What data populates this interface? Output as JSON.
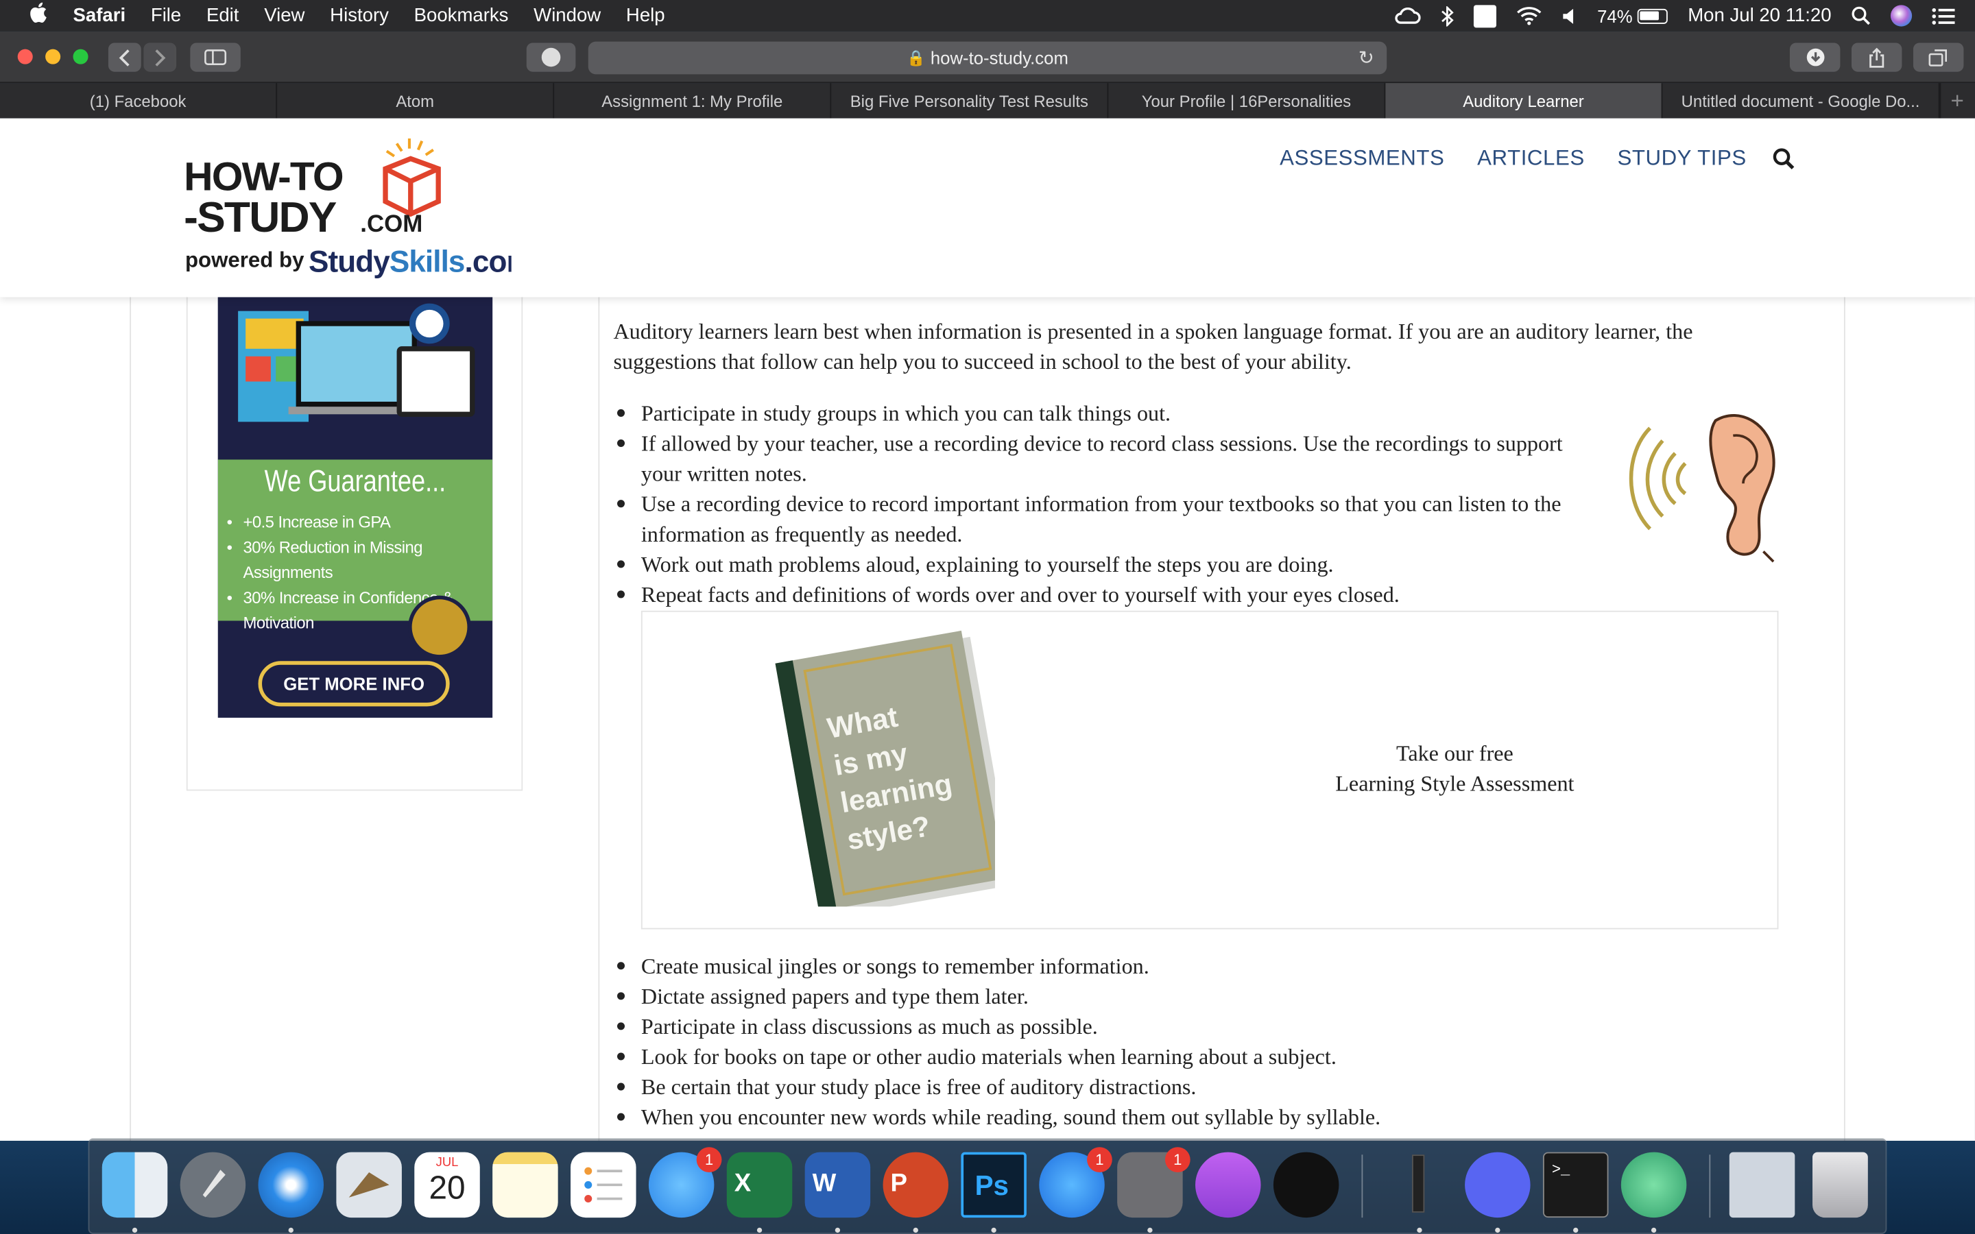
{
  "menubar": {
    "apple": "",
    "items": [
      "Safari",
      "File",
      "Edit",
      "View",
      "History",
      "Bookmarks",
      "Window",
      "Help"
    ],
    "battery": "74%",
    "datetime": "Mon Jul 20  11:20"
  },
  "browser": {
    "url": "how-to-study.com",
    "tabs": [
      "(1) Facebook",
      "Atom",
      "Assignment 1: My Profile",
      "Big Five Personality Test Results",
      "Your Profile | 16Personalities",
      "Auditory Learner",
      "Untitled document - Google Do..."
    ],
    "active_tab": 5,
    "new_tab": "+"
  },
  "site": {
    "logo_line1": "HOW-TO",
    "logo_line2": "-STUDY",
    "logo_dotcom": ".COM",
    "powered_by": "powered by",
    "powered_brand_a": "Study",
    "powered_brand_b": "Skills",
    "powered_brand_c": ".com",
    "nav": [
      "ASSESSMENTS",
      "ARTICLES",
      "STUDY TIPS"
    ]
  },
  "ad": {
    "title": "We Guarantee...",
    "items": [
      "+0.5 Increase in GPA",
      "30% Reduction in Missing Assignments",
      "30% Increase in Confidence & Motivation"
    ],
    "cta": "GET MORE INFO"
  },
  "article": {
    "intro": "Auditory learners learn best when information is presented in a spoken language format. If you are an auditory learner, the suggestions that follow can help you to succeed in school to the best of your ability.",
    "tips1": [
      "Participate in study groups in which you can talk things out.",
      "If allowed by your teacher, use a recording device to record class sessions. Use the recordings to support your written notes.",
      "Use a recording device to record important information from your textbooks so that you can listen to the information as frequently as needed.",
      "Work out math problems aloud, explaining to yourself the steps you are doing.",
      "Repeat facts and definitions of words over and over to yourself with your eyes closed."
    ],
    "book_text": [
      "What",
      "is my",
      "learning",
      "style?"
    ],
    "assess_line1": "Take our free",
    "assess_line2": "Learning Style Assessment",
    "tips2": [
      "Create musical jingles or songs to remember information.",
      "Dictate assigned papers and type them later.",
      "Participate in class discussions as much as possible.",
      "Look for books on tape or other audio materials when learning about a subject.",
      "Be certain that your study place is free of auditory distractions.",
      "When you encounter new words while reading, sound them out syllable by syllable."
    ]
  },
  "dock": {
    "apps": [
      "Finder",
      "Launchpad",
      "Safari",
      "Mail",
      "Calendar",
      "Notes",
      "Reminders",
      "Messages",
      "Excel",
      "Word",
      "PowerPoint",
      "Photoshop",
      "App Store",
      "System Preferences",
      "Podcasts",
      "TV",
      "Audio",
      "Discord",
      "Terminal",
      "Atom",
      "Preview",
      "Trash"
    ],
    "calendar_month": "JUL",
    "calendar_day": "20",
    "badges": {
      "messages": "1",
      "appstore": "1",
      "sysprefs": "1"
    }
  }
}
